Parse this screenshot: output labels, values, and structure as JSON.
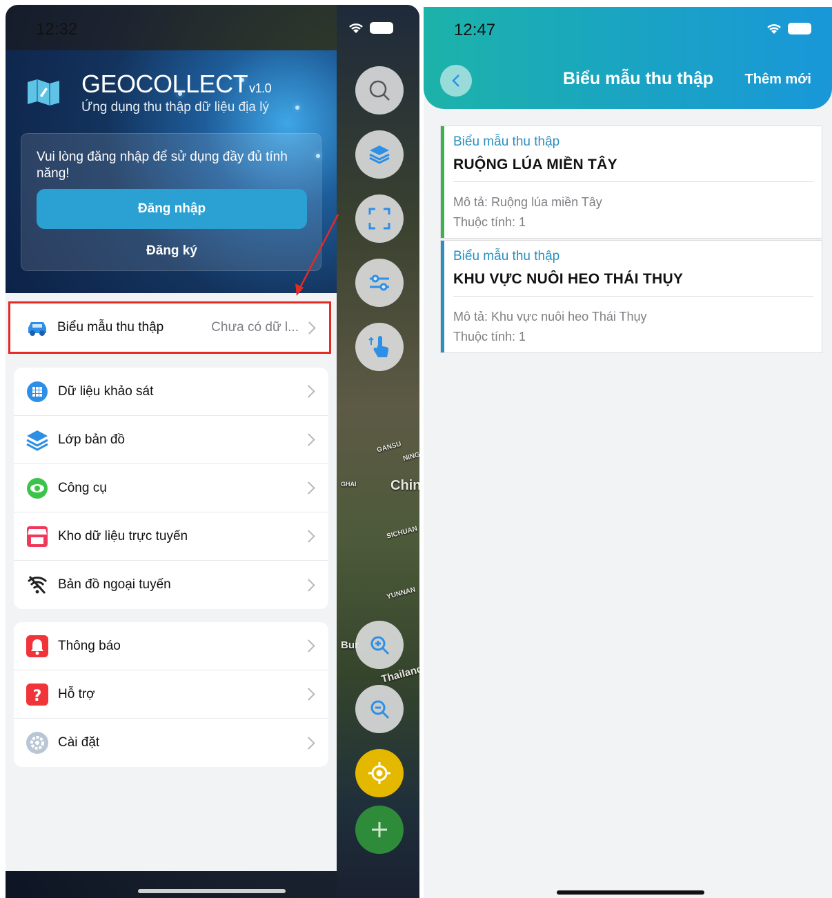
{
  "left_screen": {
    "status": {
      "time": "12:32"
    },
    "drawer": {
      "app_title": "GEOCOLLECT",
      "app_version": "v1.0",
      "app_subtitle": "Ứng dụng thu thập dữ liệu địa lý",
      "login_message": "Vui lòng đăng nhập để sử dụng đầy đủ tính năng!",
      "login_button": "Đăng nhập",
      "register_button": "Đăng ký"
    },
    "highlighted_item": {
      "label": "Biểu mẫu thu thập",
      "value": "Chưa có dữ l..."
    },
    "menu_group_1": [
      {
        "label": "Dữ liệu khảo sát",
        "icon": "grid-icon"
      },
      {
        "label": "Lớp bản đồ",
        "icon": "layers-icon"
      },
      {
        "label": "Công cụ",
        "icon": "eye-icon"
      },
      {
        "label": "Kho dữ liệu trực tuyến",
        "icon": "store-icon"
      },
      {
        "label": "Bản đồ ngoại tuyến",
        "icon": "wifi-off-icon"
      }
    ],
    "menu_group_2": [
      {
        "label": "Thông báo",
        "icon": "bell-icon"
      },
      {
        "label": "Hỗ trợ",
        "icon": "help-icon"
      },
      {
        "label": "Cài đặt",
        "icon": "settings-icon"
      }
    ],
    "map_labels": [
      "China",
      "GANSU",
      "NING",
      "SICHUAN",
      "YUNNAN",
      "Thailand",
      "Bur",
      "GHAI"
    ],
    "colors": {
      "accent": "#2aa0d3",
      "highlight_border": "#e52a24",
      "locate_button": "#e5b800",
      "add_button": "#2e8b3a"
    }
  },
  "right_screen": {
    "status": {
      "time": "12:47"
    },
    "header": {
      "title": "Biểu mẫu thu thập",
      "add_button": "Thêm mới"
    },
    "forms": [
      {
        "kicker": "Biểu mẫu thu thập",
        "title": "RUỘNG LÚA MIỀN TÂY",
        "description": "Mô tả: Ruộng lúa miền Tây",
        "attributes": "Thuộc tính: 1",
        "bar_color": "#3cb34a"
      },
      {
        "kicker": "Biểu mẫu thu thập",
        "title": "KHU VỰC NUÔI HEO THÁI THỤY",
        "description": "Mô tả: Khu vực nuôi heo Thái Thụy",
        "attributes": "Thuộc tính: 1",
        "bar_color": "#2b8fbf"
      }
    ],
    "colors": {
      "header_start": "#1cb3a9",
      "header_end": "#1997d9"
    }
  }
}
